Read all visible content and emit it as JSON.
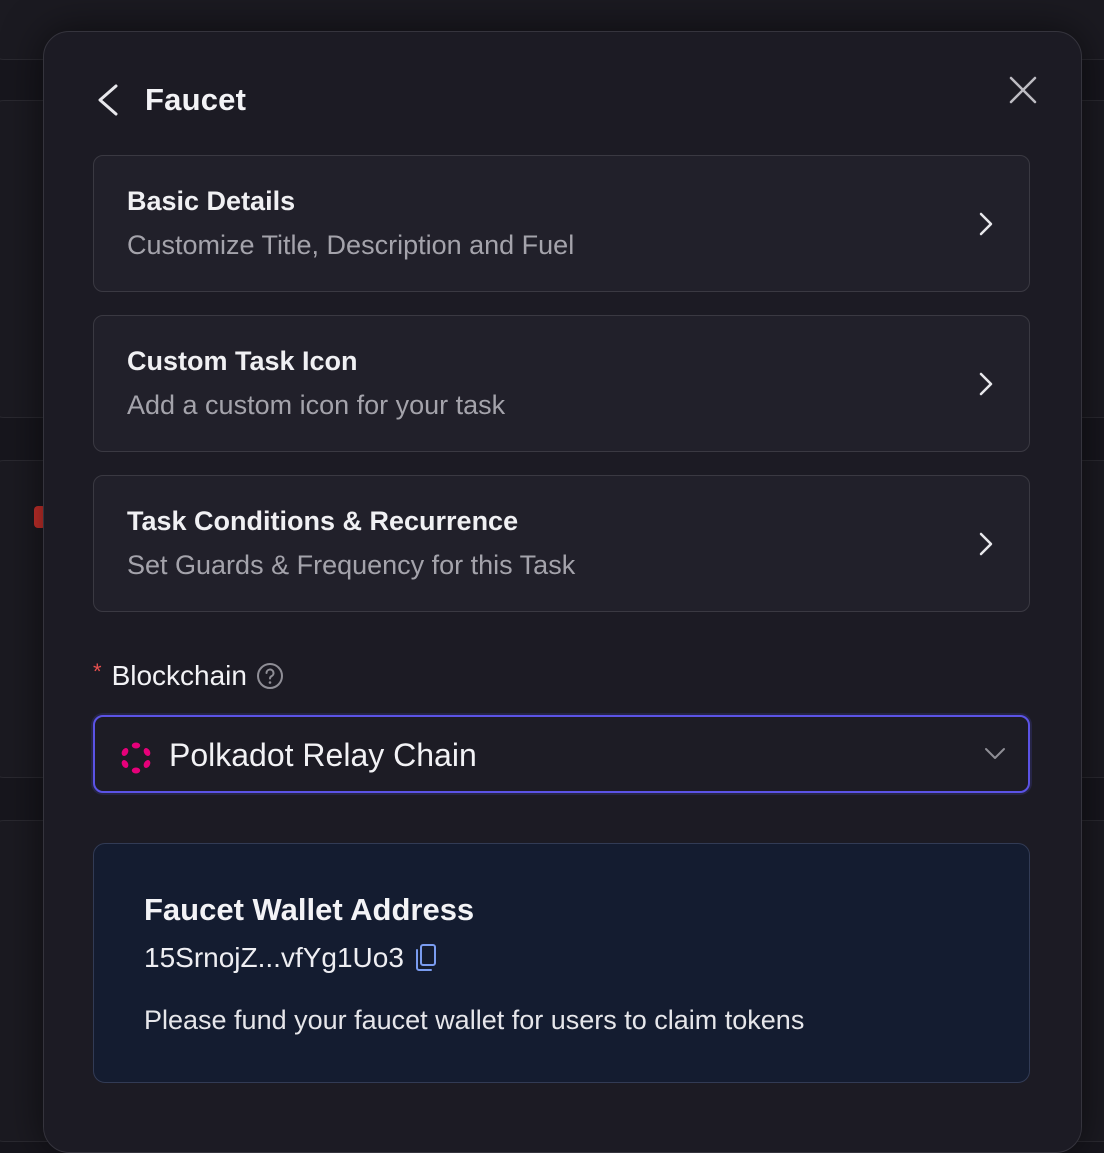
{
  "modal": {
    "title": "Faucet"
  },
  "sections": [
    {
      "title": "Basic Details",
      "subtitle": "Customize Title, Description and Fuel"
    },
    {
      "title": "Custom Task Icon",
      "subtitle": "Add a custom icon for your task"
    },
    {
      "title": "Task Conditions & Recurrence",
      "subtitle": "Set Guards & Frequency for this Task"
    }
  ],
  "blockchain_field": {
    "required_mark": "*",
    "label": "Blockchain",
    "selected_value": "Polkadot Relay Chain",
    "selected_icon": "polkadot-logo-icon"
  },
  "wallet": {
    "title": "Faucet Wallet Address",
    "address": "15SrnojZ...vfYg1Uo3",
    "note": "Please fund your faucet wallet for users to claim tokens"
  },
  "colors": {
    "accent_border": "#5b53e6",
    "required": "#e8504f",
    "polkadot": "#e6007a",
    "copy_icon": "#7a9cf0"
  }
}
